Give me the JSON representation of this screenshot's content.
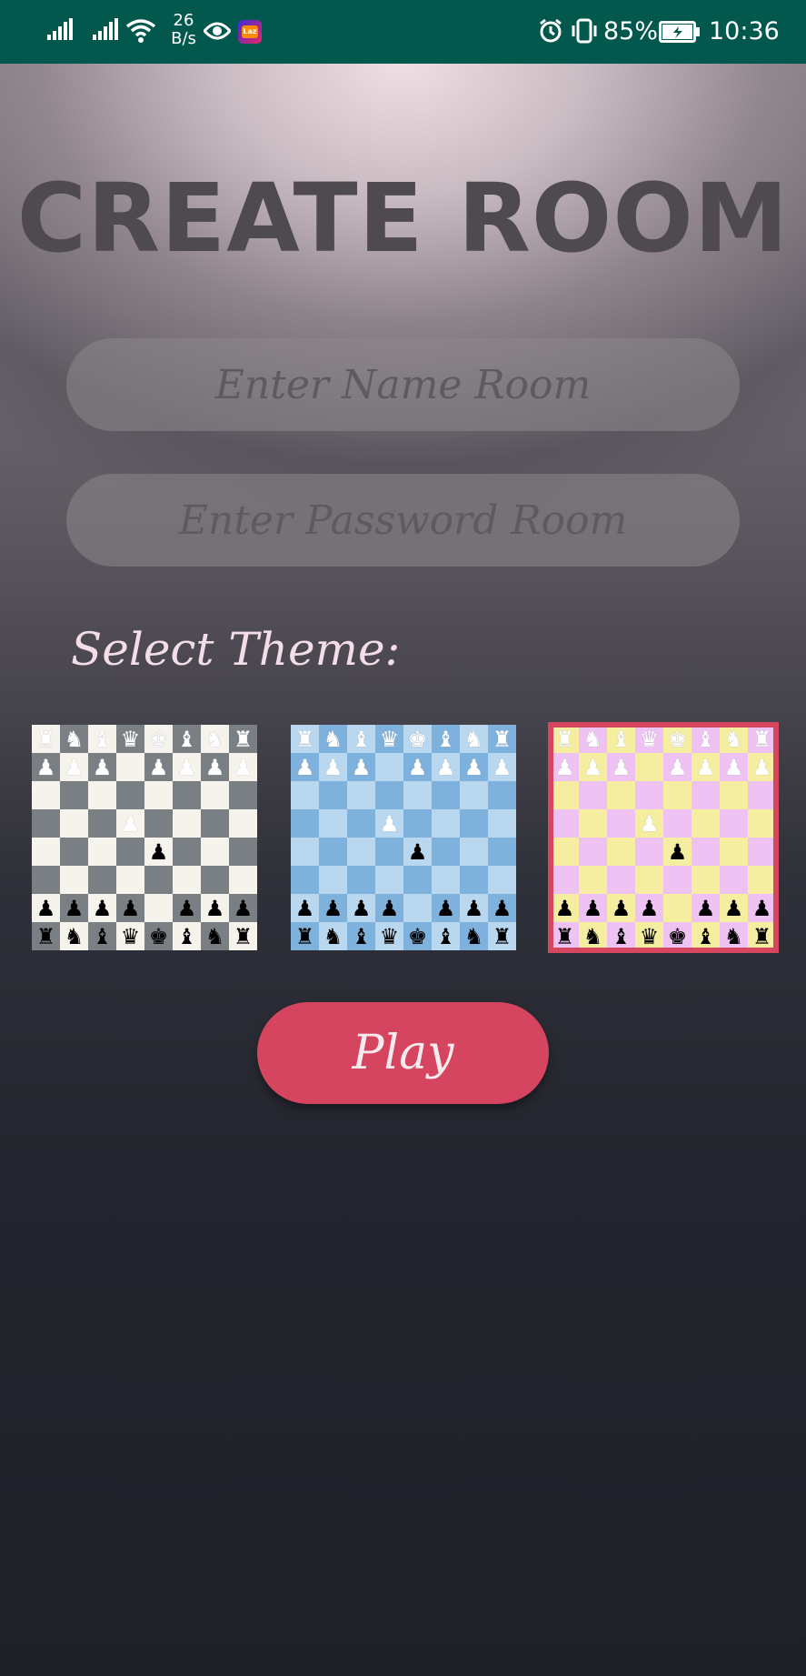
{
  "status_bar": {
    "speed_value": "26",
    "speed_unit": "B/s",
    "battery": "85%",
    "time": "10:36",
    "app_icon_text": "Laz",
    "icons": [
      "signal-icon",
      "signal-icon",
      "wifi-icon",
      "eye-icon",
      "app-icon",
      "alarm-icon",
      "vibrate-icon",
      "battery-charging-icon"
    ]
  },
  "page": {
    "title": "CREATE ROOM",
    "name_placeholder": "Enter Name Room",
    "password_placeholder": "Enter Password Room",
    "select_theme_label": "Select Theme:",
    "play_label": "Play"
  },
  "themes": [
    {
      "name": "gray",
      "light": "#f6f2ec",
      "dark": "#7a7f83",
      "selected": false
    },
    {
      "name": "blue",
      "light": "#b9d7ef",
      "dark": "#7fb1dd",
      "selected": false
    },
    {
      "name": "pink-yellow",
      "light": "#f5eda0",
      "dark": "#eec3f4",
      "selected": true
    }
  ],
  "board": {
    "rows": [
      [
        "♜",
        "♞",
        "♝",
        "♛",
        "♚",
        "♝",
        "♞",
        "♜"
      ],
      [
        "♟",
        "♟",
        "♟",
        "",
        "♟",
        "♟",
        "♟",
        "♟"
      ],
      [
        "",
        "",
        "",
        "",
        "",
        "",
        "",
        ""
      ],
      [
        "",
        "",
        "",
        "♟",
        "",
        "",
        "",
        ""
      ],
      [
        "",
        "",
        "",
        "",
        "♟",
        "",
        "",
        ""
      ],
      [
        "",
        "",
        "",
        "",
        "",
        "",
        "",
        ""
      ],
      [
        "♟",
        "♟",
        "♟",
        "♟",
        "",
        "♟",
        "♟",
        "♟"
      ],
      [
        "♜",
        "♞",
        "♝",
        "♛",
        "♚",
        "♝",
        "♞",
        "♜"
      ]
    ],
    "colors": [
      [
        "w",
        "w",
        "w",
        "w",
        "w",
        "w",
        "w",
        "w"
      ],
      [
        "w",
        "w",
        "w",
        "",
        "w",
        "w",
        "w",
        "w"
      ],
      [
        "",
        "",
        "",
        "",
        "",
        "",
        "",
        ""
      ],
      [
        "",
        "",
        "",
        "w",
        "",
        "",
        "",
        ""
      ],
      [
        "",
        "",
        "",
        "",
        "b",
        "",
        "",
        ""
      ],
      [
        "",
        "",
        "",
        "",
        "",
        "",
        "",
        ""
      ],
      [
        "b",
        "b",
        "b",
        "b",
        "",
        "b",
        "b",
        "b"
      ],
      [
        "b",
        "b",
        "b",
        "b",
        "b",
        "b",
        "b",
        "b"
      ]
    ]
  },
  "colors": {
    "status_bar_bg": "#02584d",
    "accent": "#d6455f",
    "title": "#4e4a4e",
    "label": "#f3dde6"
  }
}
